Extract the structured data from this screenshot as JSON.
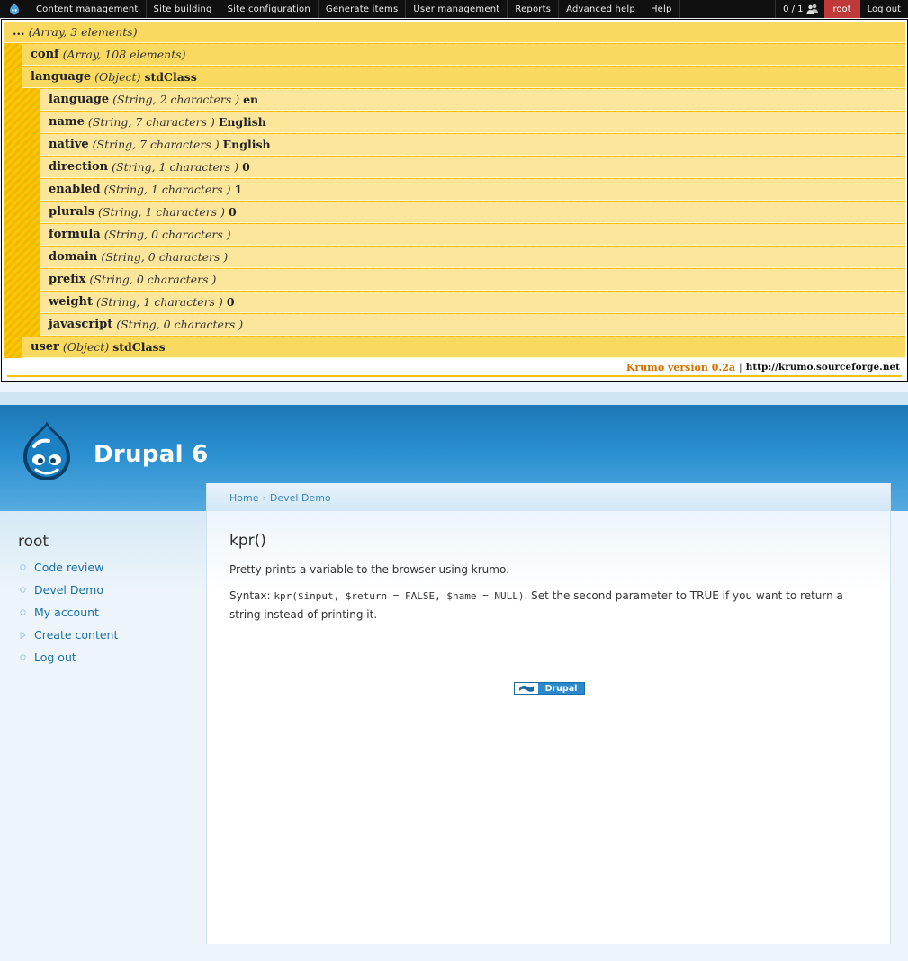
{
  "admin_menu": {
    "items": [
      {
        "label": "Content management"
      },
      {
        "label": "Site building"
      },
      {
        "label": "Site configuration"
      },
      {
        "label": "Generate items"
      },
      {
        "label": "User management"
      },
      {
        "label": "Reports"
      },
      {
        "label": "Advanced help"
      },
      {
        "label": "Help"
      }
    ],
    "users_count": "0 / 1",
    "current_user": "root",
    "logout": "Log out"
  },
  "krumo": {
    "rows": [
      {
        "name": "...",
        "type": "(Array, 3 elements)",
        "value": ""
      },
      {
        "name": "conf",
        "type": "(Array, 108 elements)",
        "value": ""
      },
      {
        "name": "language",
        "type": "(Object)",
        "value": "stdClass"
      },
      {
        "name": "language",
        "type": "(String, 2 characters )",
        "value": "en"
      },
      {
        "name": "name",
        "type": "(String, 7 characters )",
        "value": "English"
      },
      {
        "name": "native",
        "type": "(String, 7 characters )",
        "value": "English"
      },
      {
        "name": "direction",
        "type": "(String, 1 characters )",
        "value": "0"
      },
      {
        "name": "enabled",
        "type": "(String, 1 characters )",
        "value": "1"
      },
      {
        "name": "plurals",
        "type": "(String, 1 characters )",
        "value": "0"
      },
      {
        "name": "formula",
        "type": "(String, 0 characters )",
        "value": ""
      },
      {
        "name": "domain",
        "type": "(String, 0 characters )",
        "value": ""
      },
      {
        "name": "prefix",
        "type": "(String, 0 characters )",
        "value": ""
      },
      {
        "name": "weight",
        "type": "(String, 1 characters )",
        "value": "0"
      },
      {
        "name": "javascript",
        "type": "(String, 0 characters )",
        "value": ""
      },
      {
        "name": "user",
        "type": "(Object)",
        "value": "stdClass"
      }
    ],
    "version": "Krumo version 0.2a",
    "separator": "|",
    "link": "http://krumo.sourceforge.net"
  },
  "site": {
    "name": "Drupal 6"
  },
  "breadcrumb": {
    "home": "Home",
    "sep": "›",
    "current": "Devel Demo"
  },
  "content": {
    "title": "kpr()",
    "description": "Pretty-prints a variable to the browser using krumo.",
    "syntax_label": "Syntax: ",
    "syntax_code": "kpr($input, $return = FALSE, $name = NULL)",
    "syntax_rest": ". Set the second parameter to TRUE if you want to return a string instead of printing it.",
    "powered_by": "Drupal"
  },
  "sidebar": {
    "title": "root",
    "items": [
      {
        "label": "Code review",
        "bullet": "circle"
      },
      {
        "label": "Devel Demo",
        "bullet": "circle"
      },
      {
        "label": "My account",
        "bullet": "circle"
      },
      {
        "label": "Create content",
        "bullet": "triangle"
      },
      {
        "label": "Log out",
        "bullet": "circle"
      }
    ]
  },
  "colors": {
    "admin_bar": "#101010",
    "krumo_yellow": "#fad960",
    "krumo_light": "#fce69c",
    "header_blue": "#2a8fd0",
    "link_blue": "#1a6fa8",
    "user_badge": "#bf3939"
  }
}
